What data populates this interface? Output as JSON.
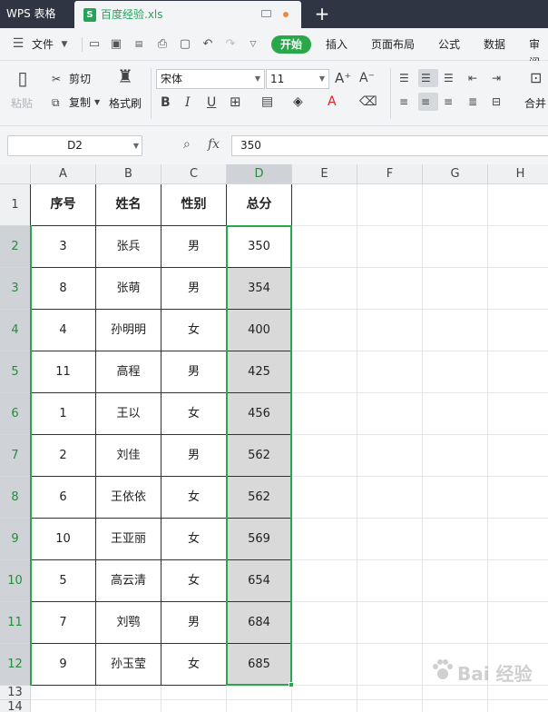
{
  "title_bar": {
    "app_name": "WPS 表格",
    "document_tab": "百度经验.xls",
    "doc_icon_letter": "S",
    "new_tab_icon": "plus-icon"
  },
  "menu": {
    "file_label": "文件",
    "items": [
      "开始",
      "插入",
      "页面布局",
      "公式",
      "数据",
      "审阅"
    ]
  },
  "ribbon": {
    "paste_label": "粘贴",
    "cut_label": "剪切",
    "copy_label": "复制",
    "format_painter_label": "格式刷",
    "font_name": "宋体",
    "font_size": "11",
    "merge_label": "合并"
  },
  "formula_bar": {
    "name_box": "D2",
    "fx_label": "fx",
    "formula": "350"
  },
  "sheet": {
    "columns": [
      "A",
      "B",
      "C",
      "D",
      "E",
      "F",
      "G",
      "H"
    ],
    "selected_column": "D",
    "rows": [
      "1",
      "2",
      "3",
      "4",
      "5",
      "6",
      "7",
      "8",
      "9",
      "10",
      "11",
      "12",
      "13",
      "14"
    ],
    "headers": [
      "序号",
      "姓名",
      "性别",
      "总分"
    ],
    "data": [
      [
        "3",
        "张兵",
        "男",
        "350"
      ],
      [
        "8",
        "张萌",
        "男",
        "354"
      ],
      [
        "4",
        "孙明明",
        "女",
        "400"
      ],
      [
        "11",
        "高程",
        "男",
        "425"
      ],
      [
        "1",
        "王以",
        "女",
        "456"
      ],
      [
        "2",
        "刘佳",
        "男",
        "562"
      ],
      [
        "6",
        "王依依",
        "女",
        "562"
      ],
      [
        "10",
        "王亚丽",
        "女",
        "569"
      ],
      [
        "5",
        "高云清",
        "女",
        "654"
      ],
      [
        "7",
        "刘鹗",
        "男",
        "684"
      ],
      [
        "9",
        "孙玉莹",
        "女",
        "685"
      ]
    ]
  },
  "watermark": {
    "text": "Bai 经验"
  },
  "colors": {
    "accent_green": "#2aa74a",
    "title_bar": "#2f3542",
    "selection_fill": "#d9d9d9"
  }
}
